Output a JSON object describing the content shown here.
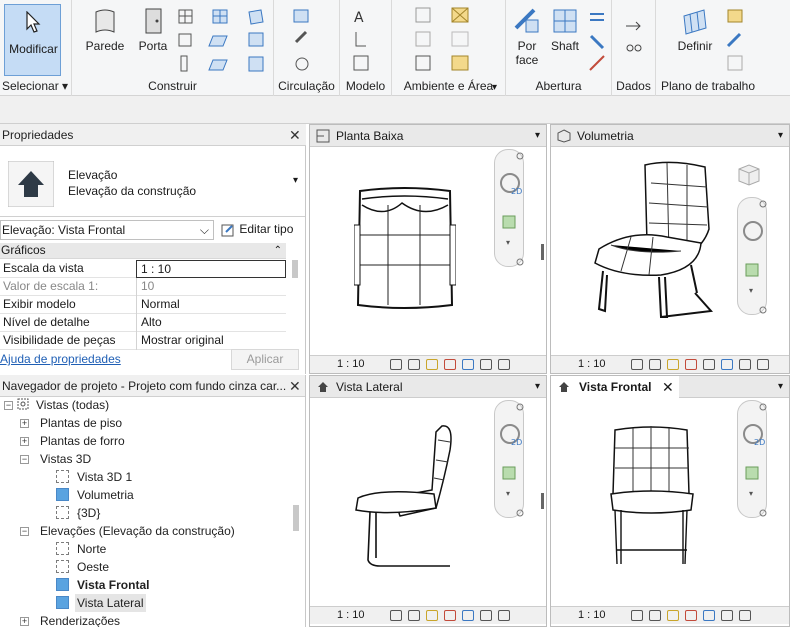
{
  "ribbon": {
    "modificar": "Modificar",
    "selecionar": "Selecionar",
    "parede": "Parede",
    "porta": "Porta",
    "construir": "Construir",
    "circulacao": "Circulação",
    "modelo": "Modelo",
    "ambiente_area": "Ambiente e Área",
    "por": "Por",
    "face": "face",
    "shaft": "Shaft",
    "abertura": "Abertura",
    "dados": "Dados",
    "definir": "Definir",
    "plano_trabalho": "Plano de trabalho"
  },
  "properties": {
    "title": "Propriedades",
    "type_line1": "Elevação",
    "type_line2": "Elevação da construção",
    "selector": "Elevação: Vista Frontal",
    "edit_type": "Editar tipo",
    "section": "Gráficos",
    "rows": [
      {
        "k": "Escala da vista",
        "v": "1 : 10"
      },
      {
        "k": "Valor de escala    1:",
        "v": "10"
      },
      {
        "k": "Exibir modelo",
        "v": "Normal"
      },
      {
        "k": "Nível de detalhe",
        "v": "Alto"
      },
      {
        "k": "Visibilidade de peças",
        "v": "Mostrar original"
      }
    ],
    "help": "Ajuda de propriedades",
    "apply": "Aplicar"
  },
  "browser": {
    "title": "Navegador de projeto - Projeto com fundo cinza car...",
    "views_all": "Vistas (todas)",
    "plantas_piso": "Plantas de piso",
    "plantas_forro": "Plantas de forro",
    "vistas3d": "Vistas 3D",
    "vista3d1": "Vista 3D 1",
    "volumetria": "Volumetria",
    "v3d": "{3D}",
    "elevacoes": "Elevações (Elevação da construção)",
    "norte": "Norte",
    "oeste": "Oeste",
    "vista_frontal": "Vista Frontal",
    "vista_lateral": "Vista Lateral",
    "renderizacoes": "Renderizações"
  },
  "views": {
    "planta": "Planta Baixa",
    "volumetria": "Volumetria",
    "lateral": "Vista Lateral",
    "frontal": "Vista Frontal",
    "scale": "1 : 10"
  }
}
